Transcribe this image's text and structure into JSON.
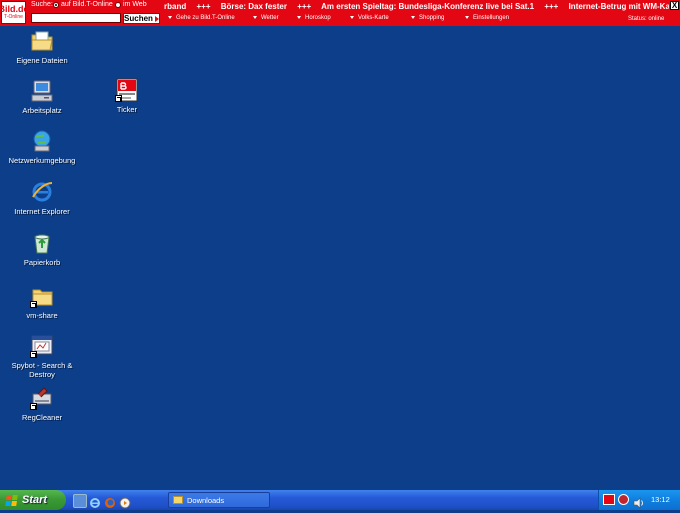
{
  "toolbar": {
    "logo_text": "Bild.de",
    "logo_sub": "T-Online",
    "search_label": "Suche:",
    "radio_options": [
      "auf Bild.T-Online",
      "im Web"
    ],
    "search_value": "",
    "search_button": "Suchen",
    "ticker_items": [
      "rband",
      "+++",
      "Börse: Dax fester",
      "+++",
      "Am ersten Spieltag: Bundesliga-Konferenz live bei Sat.1",
      "+++",
      "Internet-Betrug mit WM-Karten: Festa"
    ],
    "nav_links": [
      "Gehe zu Bild.T-Online",
      "Wetter",
      "Horoskop",
      "Volks-Karte",
      "Shopping",
      "Einstellungen"
    ],
    "status": "Status: online",
    "close_glyph": "X"
  },
  "desktop": {
    "icons": [
      {
        "label": "Eigene Dateien",
        "icon": "my-documents-icon"
      },
      {
        "label": "Arbeitsplatz",
        "icon": "my-computer-icon"
      },
      {
        "label": "Netzwerkumgebung",
        "icon": "network-icon"
      },
      {
        "label": "Internet Explorer",
        "icon": "internet-explorer-icon"
      },
      {
        "label": "Papierkorb",
        "icon": "recycle-bin-icon"
      },
      {
        "label": "vm-share",
        "icon": "folder-shortcut-icon"
      },
      {
        "label": "Spybot - Search & Destroy",
        "icon": "spybot-icon"
      },
      {
        "label": "RegCleaner",
        "icon": "regcleaner-icon"
      },
      {
        "label": "Ticker",
        "icon": "bild-ticker-icon"
      }
    ]
  },
  "taskbar": {
    "start_label": "Start",
    "quick_launch": [
      "show-desktop-icon",
      "internet-explorer-icon",
      "firefox-icon",
      "media-player-icon"
    ],
    "tasks": [
      {
        "label": "Downloads",
        "icon": "folder-icon"
      }
    ],
    "tray_icons": [
      "bild-tray-icon",
      "security-shield-icon",
      "volume-icon"
    ],
    "clock": "13:12"
  },
  "colors": {
    "desktop_bg": "#0d3e8a",
    "toolbar_red": "#e30613",
    "taskbar_blue": "#2459d6",
    "start_green": "#3c9a36"
  }
}
